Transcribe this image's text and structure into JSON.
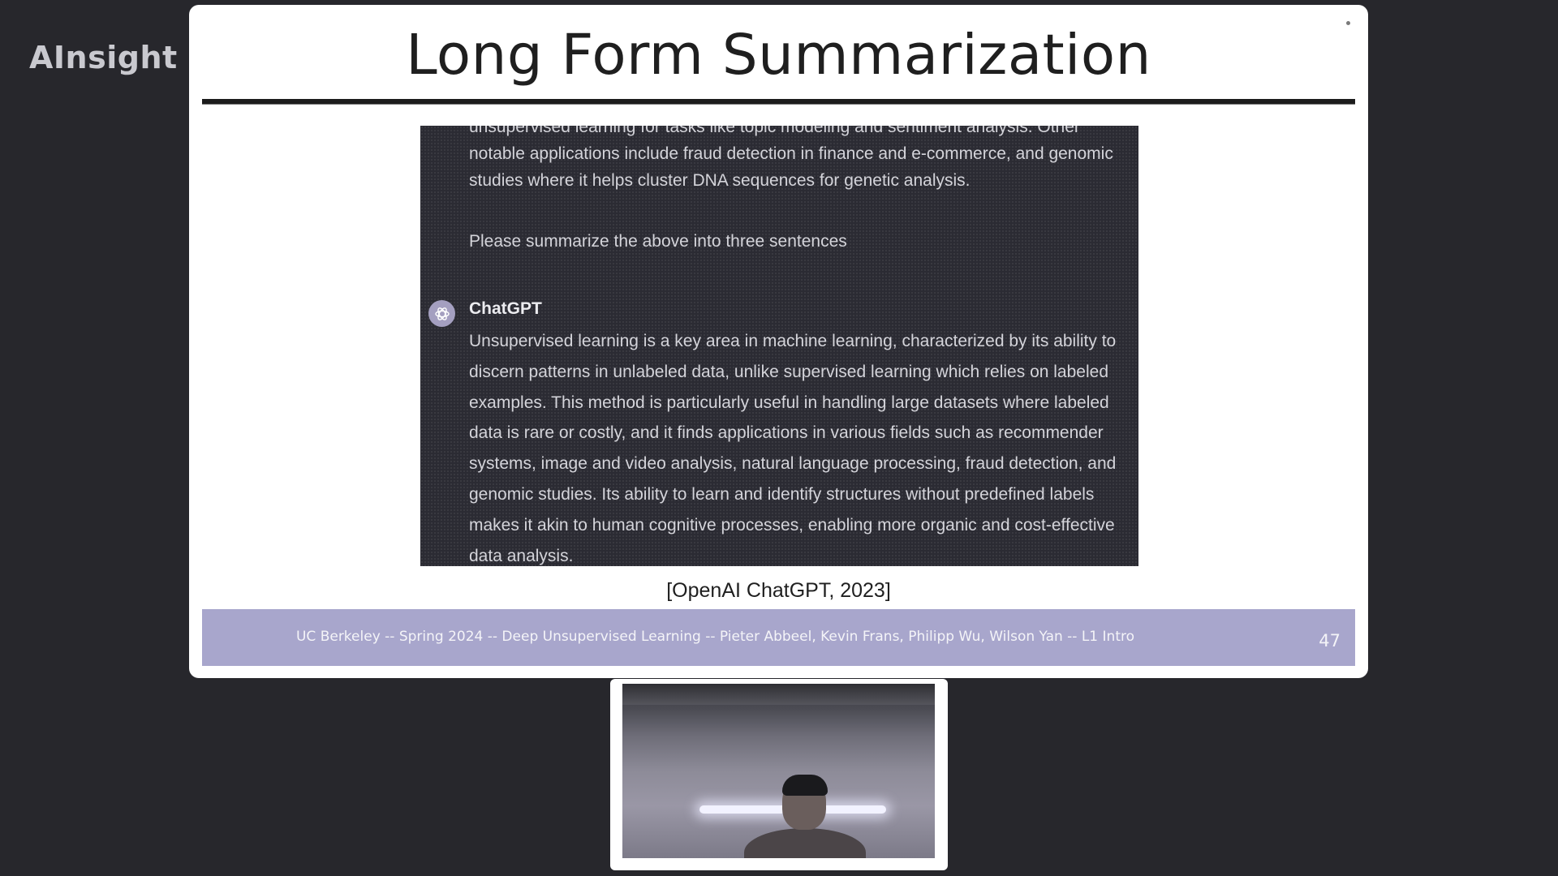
{
  "watermark": {
    "text": "AInsight",
    "logo_icon": "bilibili-logo-icon"
  },
  "slide": {
    "title": "Long Form Summarization",
    "chat": {
      "previous_message_lines": [
        "unsupervised learning for tasks like topic modeling and sentiment analysis. Other",
        "notable applications include fraud detection in finance and e-commerce, and genomic",
        "studies where it helps cluster DNA sequences for genetic analysis."
      ],
      "prompt": "Please summarize the above into three sentences",
      "assistant_icon": "openai-logo-icon",
      "assistant_name": "ChatGPT",
      "reply_lines": [
        "Unsupervised learning is a key area in machine learning, characterized by its ability to",
        "discern patterns in unlabeled data, unlike supervised learning which relies on labeled",
        "examples. This method is particularly useful in handling large datasets where labeled",
        "data is rare or costly, and it finds applications in various fields such as recommender",
        "systems, image and video analysis, natural language processing, fraud detection, and",
        "genomic studies. Its ability to learn and identify structures without predefined labels",
        "makes it akin to human cognitive processes, enabling more organic and cost-effective",
        "data analysis."
      ]
    },
    "citation": "[OpenAI ChatGPT, 2023]",
    "footer": {
      "text": "UC Berkeley -- Spring 2024 -- Deep Unsupervised Learning -- Pieter Abbeel, Kevin Frans, Philipp Wu, Wilson Yan -- L1 Intro",
      "page_number": "47"
    }
  },
  "webcam": {
    "feed_icon": "webcam-feed"
  },
  "colors": {
    "background": "#27272c",
    "chat_bg": "#2b2b33",
    "footer_bg": "#a8a6cc",
    "avatar": "#a49fc0"
  }
}
